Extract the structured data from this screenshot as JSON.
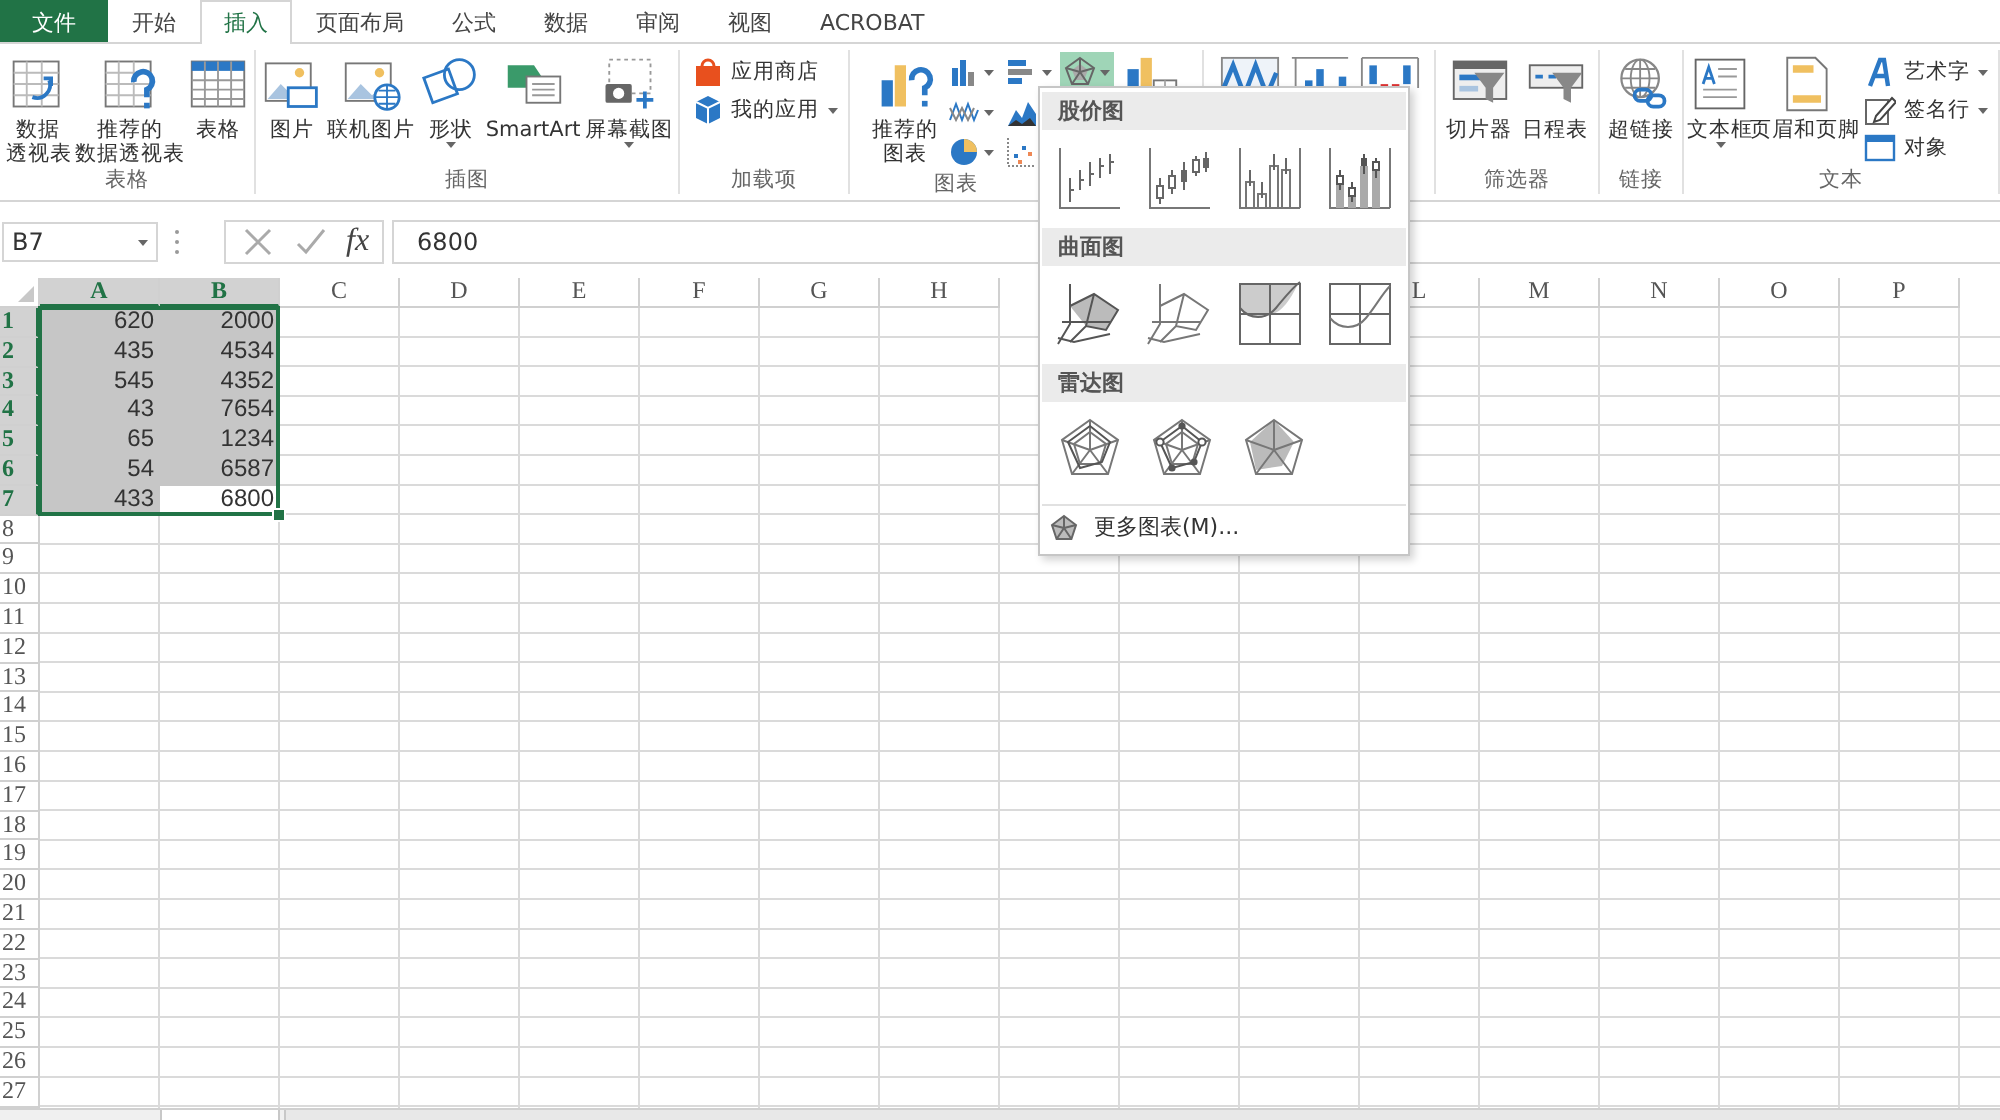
{
  "tabs": [
    {
      "label": "文件",
      "kind": "file",
      "selected": false
    },
    {
      "label": "开始",
      "kind": "tab",
      "selected": false
    },
    {
      "label": "插入",
      "kind": "tab",
      "selected": true
    },
    {
      "label": "页面布局",
      "kind": "tab",
      "selected": false
    },
    {
      "label": "公式",
      "kind": "tab",
      "selected": false
    },
    {
      "label": "数据",
      "kind": "tab",
      "selected": false
    },
    {
      "label": "审阅",
      "kind": "tab",
      "selected": false
    },
    {
      "label": "视图",
      "kind": "tab",
      "selected": false
    },
    {
      "label": "ACROBAT",
      "kind": "tab",
      "selected": false
    }
  ],
  "ribbon": {
    "groups": [
      {
        "label": "表格",
        "items": [
          {
            "kind": "large",
            "lines": [
              "数据",
              "透视表"
            ],
            "dropdown": false
          },
          {
            "kind": "large",
            "lines": [
              "推荐的",
              "数据透视表"
            ],
            "dropdown": false
          },
          {
            "kind": "large",
            "lines": [
              "表格"
            ],
            "dropdown": false
          }
        ]
      },
      {
        "label": "插图",
        "items": [
          {
            "kind": "large",
            "lines": [
              "图片"
            ],
            "dropdown": false
          },
          {
            "kind": "large",
            "lines": [
              "联机图片"
            ],
            "dropdown": false
          },
          {
            "kind": "large",
            "lines": [
              "形状"
            ],
            "dropdown": true
          },
          {
            "kind": "large",
            "lines": [
              "SmartArt"
            ],
            "dropdown": false
          },
          {
            "kind": "large",
            "lines": [
              "屏幕截图"
            ],
            "dropdown": true
          }
        ]
      },
      {
        "label": "加载项",
        "items": [
          {
            "kind": "small_stack",
            "buttons": [
              {
                "label": "应用商店",
                "dropdown": false
              },
              {
                "label": "我的应用",
                "dropdown": true
              }
            ]
          }
        ]
      },
      {
        "label": "图表",
        "items": [
          {
            "kind": "large",
            "lines": [
              "推荐的",
              "图表"
            ],
            "dropdown": false
          },
          {
            "kind": "icon_grid",
            "buttons": [
              {
                "selected": false
              },
              {
                "selected": false
              },
              {
                "selected": false
              },
              {
                "selected": false
              },
              {
                "selected": false
              },
              {
                "selected": false
              },
              {
                "selected": true
              }
            ]
          },
          {
            "kind": "large_icon"
          }
        ]
      },
      {
        "items": [
          {
            "kind": "large_icon"
          },
          {
            "kind": "large_icon"
          },
          {
            "kind": "large_icon"
          }
        ]
      },
      {
        "label": "筛选器",
        "items": [
          {
            "kind": "large",
            "lines": [
              "切片器"
            ],
            "dropdown": false
          },
          {
            "kind": "large",
            "lines": [
              "日程表"
            ],
            "dropdown": false
          }
        ]
      },
      {
        "label": "链接",
        "items": [
          {
            "kind": "large",
            "lines": [
              "超链接"
            ],
            "dropdown": false
          }
        ]
      },
      {
        "label": "文本",
        "items": [
          {
            "kind": "large",
            "lines": [
              "文本框"
            ],
            "dropdown": true
          },
          {
            "kind": "large",
            "lines": [
              "页眉和页脚"
            ],
            "dropdown": false
          },
          {
            "kind": "small_stack",
            "buttons": [
              {
                "label": "艺术字",
                "dropdown": true
              },
              {
                "label": "签名行",
                "dropdown": true
              },
              {
                "label": "对象",
                "dropdown": false
              }
            ]
          }
        ]
      }
    ]
  },
  "formula_bar": {
    "name_box": "B7",
    "function_label": "fx",
    "value": "6800"
  },
  "sheet": {
    "columns": [
      {
        "label": "A",
        "selected": true
      },
      {
        "label": "B",
        "selected": true
      },
      {
        "label": "C",
        "selected": false
      },
      {
        "label": "D",
        "selected": false
      },
      {
        "label": "E",
        "selected": false
      },
      {
        "label": "F",
        "selected": false
      },
      {
        "label": "G",
        "selected": false
      },
      {
        "label": "H",
        "selected": false
      },
      {},
      {},
      {},
      {
        "label": "L",
        "selected": false
      },
      {
        "label": "M",
        "selected": false
      },
      {
        "label": "N",
        "selected": false
      },
      {
        "label": "O",
        "selected": false
      },
      {
        "label": "P",
        "selected": false
      }
    ],
    "rows": [
      {
        "header": "1",
        "selected": true,
        "cells": [
          {
            "value": "620",
            "selected": true,
            "active": false
          },
          {
            "value": "2000",
            "selected": true,
            "active": false
          }
        ]
      },
      {
        "header": "2",
        "selected": true,
        "cells": [
          {
            "value": "435",
            "selected": true,
            "active": false
          },
          {
            "value": "4534",
            "selected": true,
            "active": false
          }
        ]
      },
      {
        "header": "3",
        "selected": true,
        "cells": [
          {
            "value": "545",
            "selected": true,
            "active": false
          },
          {
            "value": "4352",
            "selected": true,
            "active": false
          }
        ]
      },
      {
        "header": "4",
        "selected": true,
        "cells": [
          {
            "value": "43",
            "selected": true,
            "active": false
          },
          {
            "value": "7654",
            "selected": true,
            "active": false
          }
        ]
      },
      {
        "header": "5",
        "selected": true,
        "cells": [
          {
            "value": "65",
            "selected": true,
            "active": false
          },
          {
            "value": "1234",
            "selected": true,
            "active": false
          }
        ]
      },
      {
        "header": "6",
        "selected": true,
        "cells": [
          {
            "value": "54",
            "selected": true,
            "active": false
          },
          {
            "value": "6587",
            "selected": true,
            "active": false
          }
        ]
      },
      {
        "header": "7",
        "selected": true,
        "cells": [
          {
            "value": "433",
            "selected": true,
            "active": false
          },
          {
            "value": "6800",
            "selected": true,
            "active": true
          }
        ]
      },
      {
        "header": "8",
        "selected": false
      },
      {
        "header": "9",
        "selected": false
      },
      {
        "header": "10",
        "selected": false
      },
      {
        "header": "11",
        "selected": false
      },
      {
        "header": "12",
        "selected": false
      },
      {
        "header": "13",
        "selected": false
      },
      {
        "header": "14",
        "selected": false
      },
      {
        "header": "15",
        "selected": false
      },
      {
        "header": "16",
        "selected": false
      },
      {
        "header": "17",
        "selected": false
      },
      {
        "header": "18",
        "selected": false
      },
      {
        "header": "19",
        "selected": false
      },
      {
        "header": "20",
        "selected": false
      },
      {
        "header": "21",
        "selected": false
      },
      {
        "header": "22",
        "selected": false
      },
      {
        "header": "23",
        "selected": false
      },
      {
        "header": "24",
        "selected": false
      },
      {
        "header": "25",
        "selected": false
      },
      {
        "header": "26",
        "selected": false
      },
      {
        "header": "27",
        "selected": false
      }
    ]
  },
  "chart_menu": {
    "sections": [
      {
        "title": "股价图",
        "items": [
          {
            "kind": "stock_hlc"
          },
          {
            "kind": "stock_ohlc"
          },
          {
            "kind": "stock_vhlc"
          },
          {
            "kind": "stock_vohlc"
          }
        ]
      },
      {
        "title": "曲面图",
        "items": [
          {
            "kind": "surface_3d"
          },
          {
            "kind": "surface_wire"
          },
          {
            "kind": "contour"
          },
          {
            "kind": "contour_wire"
          }
        ]
      },
      {
        "title": "雷达图",
        "items": [
          {
            "kind": "radar"
          },
          {
            "kind": "radar_markers"
          },
          {
            "kind": "radar_filled"
          }
        ]
      }
    ],
    "more": "更多图表(M)..."
  }
}
